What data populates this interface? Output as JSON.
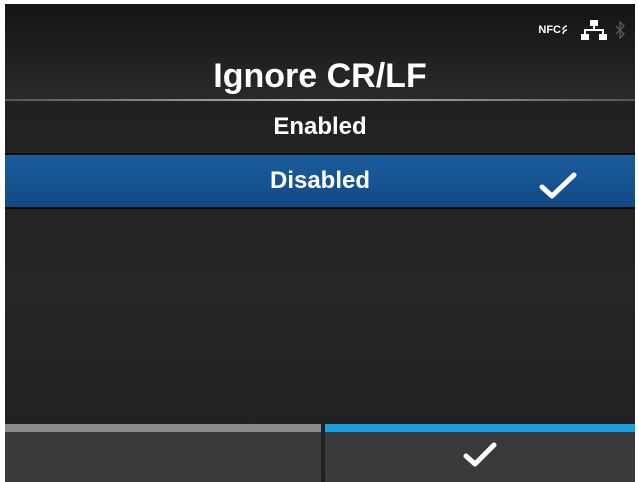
{
  "screen": {
    "title": "Ignore CR/LF",
    "status": {
      "nfc_label": "NFC",
      "icons": [
        "nfc-icon",
        "network-icon",
        "bluetooth-icon"
      ]
    },
    "options": [
      {
        "label": "Enabled",
        "selected": false
      },
      {
        "label": "Disabled",
        "selected": true
      }
    ],
    "footer": {
      "left_button": {
        "label": ""
      },
      "right_button": {
        "icon": "check-icon"
      }
    },
    "colors": {
      "selection": "#1b5c9c",
      "confirm_accent": "#1a9ee0",
      "left_accent": "#8a8a8a"
    }
  }
}
